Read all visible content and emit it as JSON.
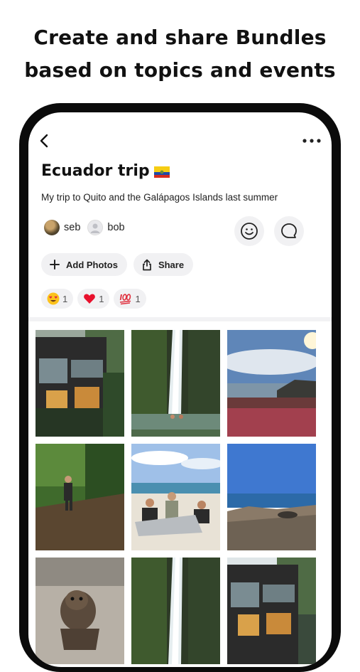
{
  "headline": {
    "line1": "Create and share Bundles",
    "line2": "based on topics and events"
  },
  "bundle": {
    "title": "Ecuador trip",
    "flag": "Ecuador flag",
    "description": "My trip to Quito and the Galápagos Islands last summer",
    "members": [
      {
        "name": "seb",
        "avatar": "photo-avatar"
      },
      {
        "name": "bob",
        "avatar": "default-avatar"
      }
    ]
  },
  "actions": {
    "add_photos": "Add Photos",
    "share": "Share"
  },
  "reactions": [
    {
      "emoji": "heart-eyes-emoji",
      "count": "1"
    },
    {
      "emoji": "red-heart-emoji",
      "count": "1"
    },
    {
      "emoji": "hundred-points-emoji",
      "count": "1"
    }
  ],
  "icons": {
    "back": "back-chevron-icon",
    "more": "more-dots-icon",
    "smiley": "smiley-icon",
    "comment": "comment-bubble-icon"
  },
  "photos": [
    "modern-house-at-night",
    "waterfall-with-swimmers",
    "coastline-at-sunset",
    "jungle-hiker",
    "beach-group-photo",
    "rocky-shore-blue-sky",
    "sea-lion-pup",
    "waterfall-with-swimmers",
    "modern-house-at-night"
  ],
  "colors": {
    "background": "#ffffff",
    "phone_frame": "#0b0b0b",
    "pill_background": "#f1f1f3",
    "text": "#111111"
  }
}
